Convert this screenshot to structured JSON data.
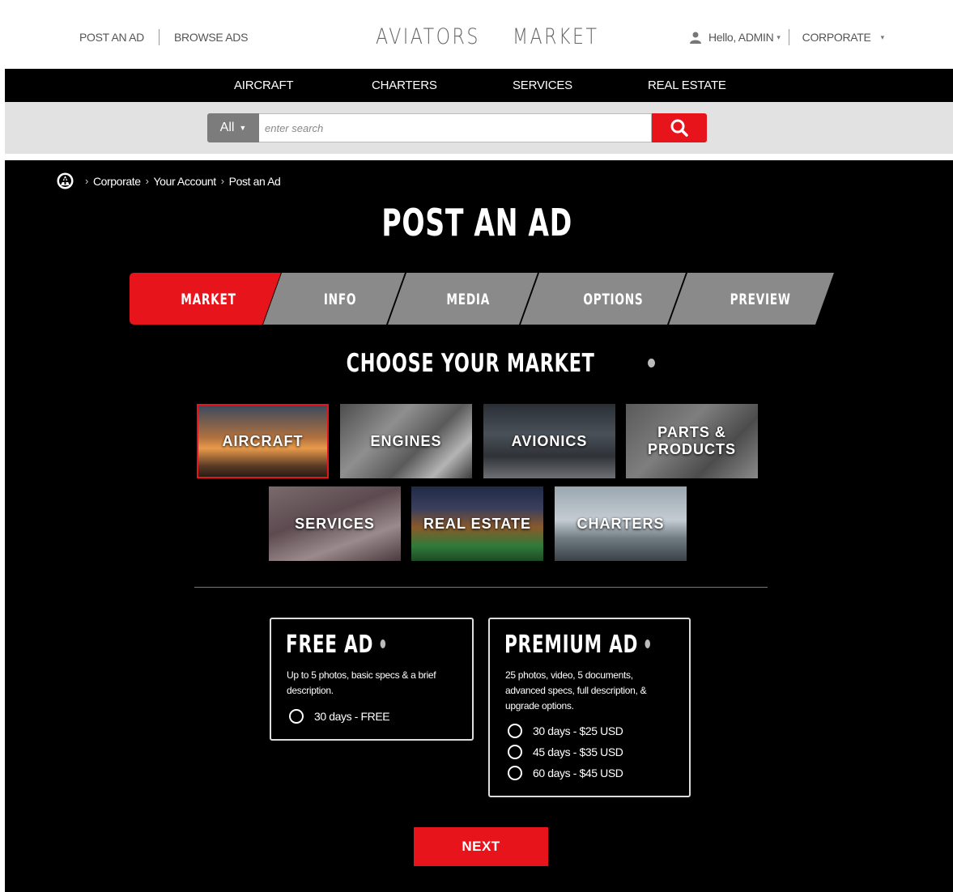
{
  "header": {
    "post_ad": "POST AN AD",
    "browse_ads": "BROWSE ADS",
    "logo_left": "AVIATORS",
    "logo_right": "MARKET",
    "greeting": "Hello, ADMIN",
    "account": "CORPORATE"
  },
  "nav": {
    "items": [
      "AIRCRAFT",
      "CHARTERS",
      "SERVICES",
      "REAL ESTATE"
    ]
  },
  "search": {
    "category": "All",
    "placeholder": "enter search"
  },
  "breadcrumb": {
    "items": [
      "Corporate",
      "Your Account",
      "Post an Ad"
    ]
  },
  "page": {
    "title": "POST AN AD"
  },
  "steps": {
    "items": [
      "MARKET",
      "INFO",
      "MEDIA",
      "OPTIONS",
      "PREVIEW"
    ],
    "active": "MARKET"
  },
  "market": {
    "title": "CHOOSE YOUR MARKET",
    "tiles": [
      "AIRCRAFT",
      "ENGINES",
      "AVIONICS",
      "PARTS &",
      "PRODUCTS",
      "SERVICES",
      "REAL ESTATE",
      "CHARTERS"
    ],
    "selected": "AIRCRAFT"
  },
  "free_ad": {
    "title": "FREE AD",
    "desc_line1": "Up to 5 photos, basic specs & a brief",
    "desc_line2": "description.",
    "options": [
      "30 days - FREE"
    ]
  },
  "premium_ad": {
    "title": "PREMIUM AD",
    "desc_line1": "25 photos, video, 5 documents,",
    "desc_line2": "advanced specs, full description, &",
    "desc_line3": "upgrade options.",
    "options": [
      "30 days - $25 USD",
      "45 days - $35 USD",
      "60 days - $45 USD"
    ]
  },
  "actions": {
    "next": "NEXT"
  },
  "colors": {
    "accent": "#e8141b",
    "step_inactive": "#8a8a8a",
    "background": "#000000"
  }
}
